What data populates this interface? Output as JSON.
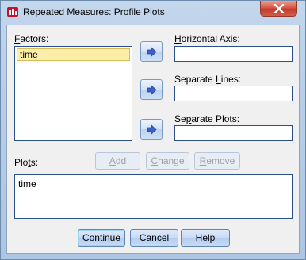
{
  "window": {
    "title": "Repeated Measures: Profile Plots"
  },
  "factors": {
    "label_prefix": "",
    "label_access": "F",
    "label_rest": "actors:",
    "items": [
      "time"
    ]
  },
  "horizontal_axis": {
    "label_access": "H",
    "label_rest": "orizontal Axis:",
    "value": ""
  },
  "separate_lines": {
    "label_prefix": "Separate ",
    "label_access": "L",
    "label_rest": "ines:",
    "value": ""
  },
  "separate_plots": {
    "label_prefix": "Se",
    "label_access": "p",
    "label_rest": "arate Plots:",
    "value": ""
  },
  "plots": {
    "label_prefix": "Plo",
    "label_access": "t",
    "label_rest": "s:",
    "items": [
      "time"
    ],
    "add_access": "A",
    "add_rest": "dd",
    "change_access": "C",
    "change_rest": "hange",
    "remove_access": "R",
    "remove_rest": "emove"
  },
  "buttons": {
    "continue": "Continue",
    "cancel": "Cancel",
    "help": "Help"
  },
  "icons": {
    "app": "spss-app-icon",
    "close": "close-icon",
    "arrow": "arrow-right-icon"
  },
  "colors": {
    "selection": "#fbeea8",
    "arrow": "#3f5fc4",
    "close_red": "#c23c2c"
  }
}
